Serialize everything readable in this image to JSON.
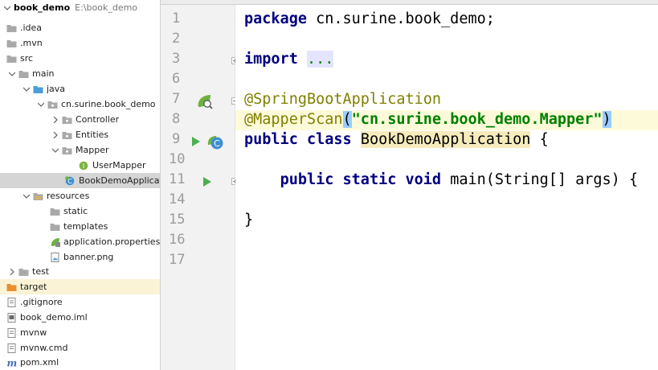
{
  "project_tree": {
    "root": {
      "name": "book_demo",
      "path": "E:\\book_demo"
    },
    "items": [
      {
        "label": ".idea",
        "icon": "folder-icon"
      },
      {
        "label": ".mvn",
        "icon": "folder-icon"
      },
      {
        "label": "src",
        "icon": "folder-icon"
      },
      {
        "label": "main",
        "icon": "folder-icon"
      },
      {
        "label": "java",
        "icon": "source-folder-icon"
      },
      {
        "label": "cn.surine.book_demo",
        "icon": "package-icon"
      },
      {
        "label": "Controller",
        "icon": "package-icon"
      },
      {
        "label": "Entities",
        "icon": "package-icon"
      },
      {
        "label": "Mapper",
        "icon": "package-icon"
      },
      {
        "label": "UserMapper",
        "icon": "interface-icon"
      },
      {
        "label": "BookDemoApplicat",
        "icon": "spring-class-icon"
      },
      {
        "label": "resources",
        "icon": "resources-folder-icon"
      },
      {
        "label": "static",
        "icon": "folder-icon"
      },
      {
        "label": "templates",
        "icon": "folder-icon"
      },
      {
        "label": "application.properties",
        "icon": "spring-properties-icon"
      },
      {
        "label": "banner.png",
        "icon": "image-file-icon"
      },
      {
        "label": "test",
        "icon": "folder-icon"
      },
      {
        "label": "target",
        "icon": "excluded-folder-icon"
      },
      {
        "label": ".gitignore",
        "icon": "text-file-icon"
      },
      {
        "label": "book_demo.iml",
        "icon": "module-file-icon"
      },
      {
        "label": "mvnw",
        "icon": "text-file-icon"
      },
      {
        "label": "mvnw.cmd",
        "icon": "text-file-icon"
      },
      {
        "label": "pom.xml",
        "icon": "maven-file-icon"
      }
    ]
  },
  "editor": {
    "line_numbers": [
      "1",
      "2",
      "3",
      "6",
      "7",
      "8",
      "9",
      "10",
      "11",
      "14",
      "15",
      "16",
      "17"
    ],
    "code": {
      "line1": {
        "kw": "package",
        "rest": " cn.surine.book_demo;"
      },
      "line3": {
        "kw": "import",
        "folded": "..."
      },
      "line7": {
        "annotation": "@SpringBootApplication"
      },
      "line8": {
        "annotation": "@MapperScan",
        "open": "(",
        "string": "\"cn.surine.book_demo.Mapper\"",
        "close": ")"
      },
      "line9": {
        "kw1": "public",
        "kw2": "class",
        "class_name": "BookDemoApplication",
        "rest": " {"
      },
      "line11": {
        "indent": "    ",
        "kw1": "public",
        "kw2": "static",
        "kw3": "void",
        "rest": " main(String[] args) {"
      },
      "line15": {
        "text": "}"
      }
    }
  },
  "colors": {
    "keyword": "#000080",
    "annotation": "#808000",
    "string": "#008000",
    "line_number": "#9b9b9b",
    "selection": "#d5d5d5",
    "caret_line": "#fcfad9"
  }
}
